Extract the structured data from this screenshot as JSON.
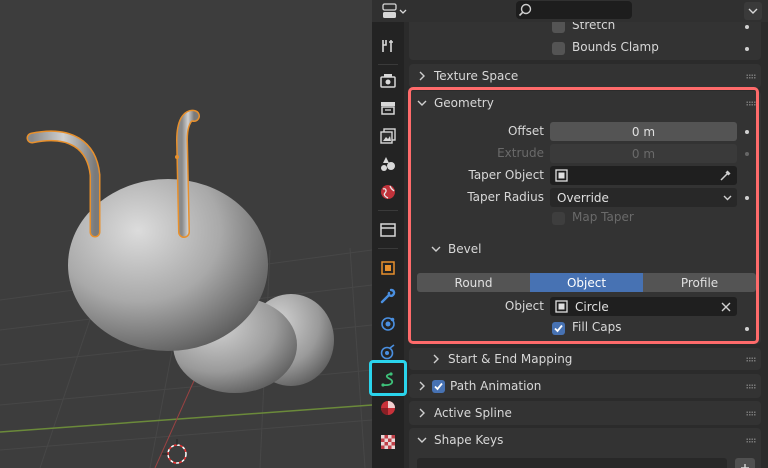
{
  "properties": {
    "top_panel": {
      "stretch_label": "Stretch",
      "bounds_clamp_label": "Bounds Clamp"
    },
    "texture_space": {
      "title": "Texture Space"
    },
    "geometry": {
      "title": "Geometry",
      "offset_label": "Offset",
      "offset_value": "0 m",
      "extrude_label": "Extrude",
      "extrude_value": "0 m",
      "taper_object_label": "Taper Object",
      "taper_radius_label": "Taper Radius",
      "taper_radius_value": "Override",
      "map_taper_label": "Map Taper",
      "bevel": {
        "title": "Bevel",
        "modes": [
          "Round",
          "Object",
          "Profile"
        ],
        "active_mode": "Object",
        "object_label": "Object",
        "object_value": "Circle",
        "fill_caps_label": "Fill Caps",
        "fill_caps_checked": true
      }
    },
    "start_end_mapping": {
      "title": "Start & End Mapping"
    },
    "path_animation": {
      "title": "Path Animation",
      "checked": true
    },
    "active_spline": {
      "title": "Active Spline"
    },
    "shape_keys": {
      "title": "Shape Keys"
    }
  },
  "tabs": [
    "tool-icon",
    "render-icon",
    "output-icon",
    "view-layer-icon",
    "scene-icon",
    "world-icon",
    "collection-icon",
    "object-icon",
    "modifier-icon",
    "particles-icon",
    "physics-icon",
    "curve-data-icon",
    "material-icon",
    "texture-icon"
  ],
  "active_tab": "curve-data-icon",
  "colors": {
    "highlight_red": "#ff6b6b",
    "highlight_cyan": "#2ad4ec",
    "accent_blue": "#4772b3",
    "selection_orange": "#e8902c"
  }
}
